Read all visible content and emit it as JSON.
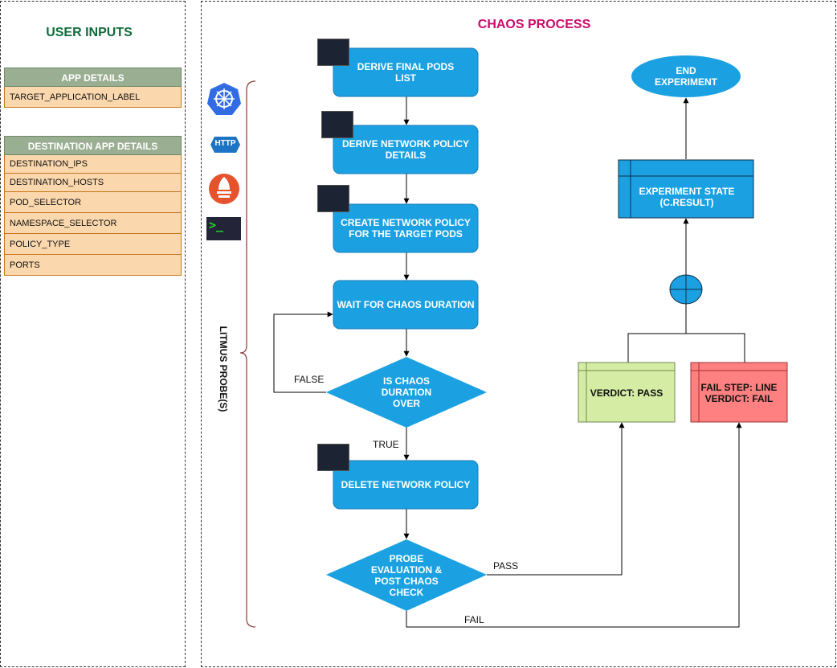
{
  "left_panel": {
    "title": "USER INPUTS",
    "app_details": {
      "header": "APP DETAILS",
      "fields": [
        "TARGET_APPLICATION_LABEL"
      ]
    },
    "destination_app_details": {
      "header": "DESTINATION APP DETAILS",
      "fields": [
        "DESTINATION_IPS",
        "DESTINATION_HOSTS",
        "POD_SELECTOR",
        "NAMESPACE_SELECTOR",
        "POLICY_TYPE",
        "PORTS"
      ]
    }
  },
  "chaos_process": {
    "title": "CHAOS PROCESS",
    "probes_label": "LITMUS PROBE(S)",
    "probe_icons": [
      "kubernetes-icon",
      "http-icon",
      "prometheus-icon",
      "terminal-icon"
    ],
    "http_badge": "HTTP",
    "terminal_glyph": ">_",
    "steps": {
      "derive_pods": [
        "DERIVE FINAL PODS",
        "LIST"
      ],
      "derive_policy": [
        "DERIVE NETWORK POLICY",
        "DETAILS"
      ],
      "create_policy": [
        "CREATE NETWORK POLICY",
        "FOR THE TARGET PODS"
      ],
      "wait": [
        "WAIT FOR CHAOS DURATION"
      ],
      "is_over": [
        "IS CHAOS",
        "DURATION",
        "OVER"
      ],
      "delete_policy": [
        "DELETE NETWORK POLICY"
      ],
      "probe_eval": [
        "PROBE",
        "EVALUATION &",
        "POST CHAOS",
        "CHECK"
      ]
    },
    "edge_labels": {
      "false": "FALSE",
      "true": "TRUE",
      "pass": "PASS",
      "fail": "FAIL"
    },
    "end_experiment": [
      "END",
      "EXPERIMENT"
    ],
    "experiment_state": [
      "EXPERIMENT STATE",
      "(C.RESULT)"
    ],
    "verdict_pass": [
      "VERDICT: PASS"
    ],
    "verdict_fail": [
      "FAIL STEP: LINE",
      "VERDICT: FAIL"
    ]
  },
  "colors": {
    "node_blue": "#1ba1e2",
    "node_border": "#1a7bb5",
    "pass_green": "#d5eca4",
    "fail_red": "#ff8080",
    "title_green": "#0f6b3a",
    "title_magenta": "#cc0a6e",
    "table_header": "#9aae92",
    "table_row": "#fad7ad"
  }
}
